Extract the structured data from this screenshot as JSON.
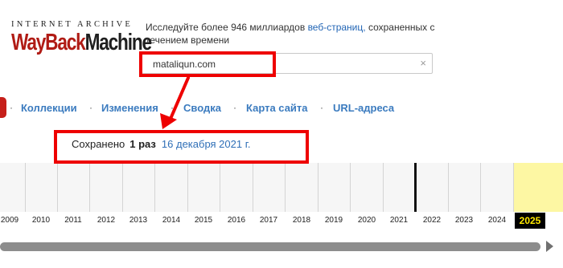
{
  "logo": {
    "top_text": "INTERNET ARCHIVE",
    "wordmark_a": "WayBack",
    "wordmark_b": "Machine"
  },
  "intro": {
    "text_before": "Исследуйте более 946 миллиардов",
    "link": "веб-страниц,",
    "text_after": "сохраненных с течением времени"
  },
  "search": {
    "value": "mataliqun.com",
    "clear_glyph": "×"
  },
  "nav": {
    "separator": "·",
    "items": [
      "Коллекции",
      "Изменения",
      "Сводка",
      "Карта сайта",
      "URL-адреса"
    ]
  },
  "saved": {
    "prefix": "Сохранено",
    "count": "1 раз",
    "date": "16 декабря 2021 г."
  },
  "timeline": {
    "years": [
      "2009",
      "2010",
      "2011",
      "2012",
      "2013",
      "2014",
      "2015",
      "2016",
      "2017",
      "2018",
      "2019",
      "2020",
      "2021",
      "2022",
      "2023",
      "2024",
      "2025"
    ],
    "current_year": "2025",
    "snapshot_year": "2021",
    "snapshot_month": 12
  },
  "colors": {
    "annotation": "#ee0000",
    "link": "#2f6fb7",
    "logo_red": "#b01b15",
    "current_year_bg": "#fdf7a3"
  }
}
